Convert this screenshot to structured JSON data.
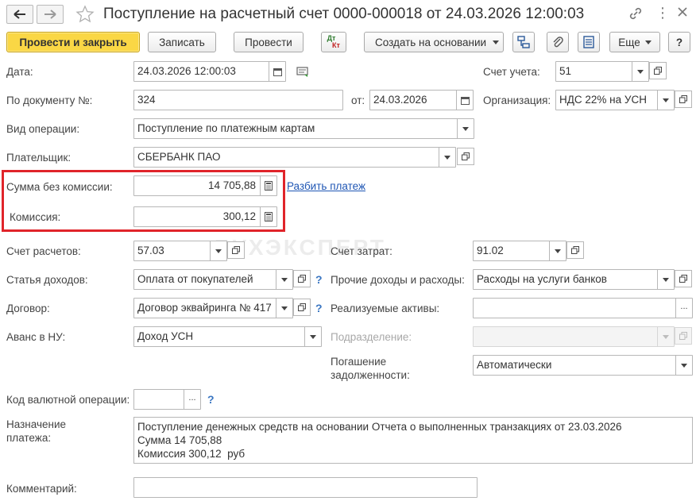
{
  "window": {
    "title": "Поступление на расчетный счет 0000-000018 от 24.03.2026 12:00:03"
  },
  "toolbar": {
    "post_close": "Провести и закрыть",
    "save": "Записать",
    "post": "Провести",
    "dtkt_top": "Дт",
    "dtkt_bottom": "Кт",
    "create_based": "Создать на основании",
    "more": "Еще",
    "help": "?"
  },
  "form": {
    "date_label": "Дата:",
    "date_value": "24.03.2026 12:00:03",
    "account_label": "Счет учета:",
    "account_value": "51",
    "doc_no_label": "По документу №:",
    "doc_no_value": "324",
    "from_label": "от:",
    "from_value": "24.03.2026",
    "org_label": "Организация:",
    "org_value": "НДС 22% на УСН",
    "op_type_label": "Вид операции:",
    "op_type_value": "Поступление по платежным картам",
    "payer_label": "Плательщик:",
    "payer_value": "СБЕРБАНК ПАО",
    "sum_label": "Сумма без комиссии:",
    "sum_value": "14 705,88",
    "split_link": "Разбить платеж",
    "commission_label": "Комиссия:",
    "commission_value": "300,12",
    "settle_acc_label": "Счет расчетов:",
    "settle_acc_value": "57.03",
    "cost_acc_label": "Счет затрат:",
    "cost_acc_value": "91.02",
    "income_item_label": "Статья доходов:",
    "income_item_value": "Оплата от покупателей",
    "other_ie_label": "Прочие доходы и расходы:",
    "other_ie_value": "Расходы на услуги банков",
    "contract_label": "Договор:",
    "contract_value": "Договор эквайринга № 417",
    "assets_label": "Реализуемые активы:",
    "assets_value": "",
    "advance_label": "Аванс в НУ:",
    "advance_value": "Доход УСН",
    "division_label": "Подразделение:",
    "division_value": "",
    "repay_label_1": "Погашение",
    "repay_label_2": "задолженности:",
    "repay_value": "Автоматически",
    "currency_op_label": "Код валютной операции:",
    "currency_op_value": "",
    "purpose_label_1": "Назначение",
    "purpose_label_2": "платежа:",
    "purpose_value": "Поступление денежных средств на основании Отчета о выполненных транзакциях от 23.03.2026\nСумма 14 705,88\nКомиссия 300,12  руб",
    "comment_label": "Комментарий:",
    "comment_value": ""
  },
  "watermark": "БУХЭКСПЕРТ",
  "colors": {
    "primary_button": "#fad745",
    "highlight_border": "#e0242a",
    "link": "#1f56b4"
  }
}
